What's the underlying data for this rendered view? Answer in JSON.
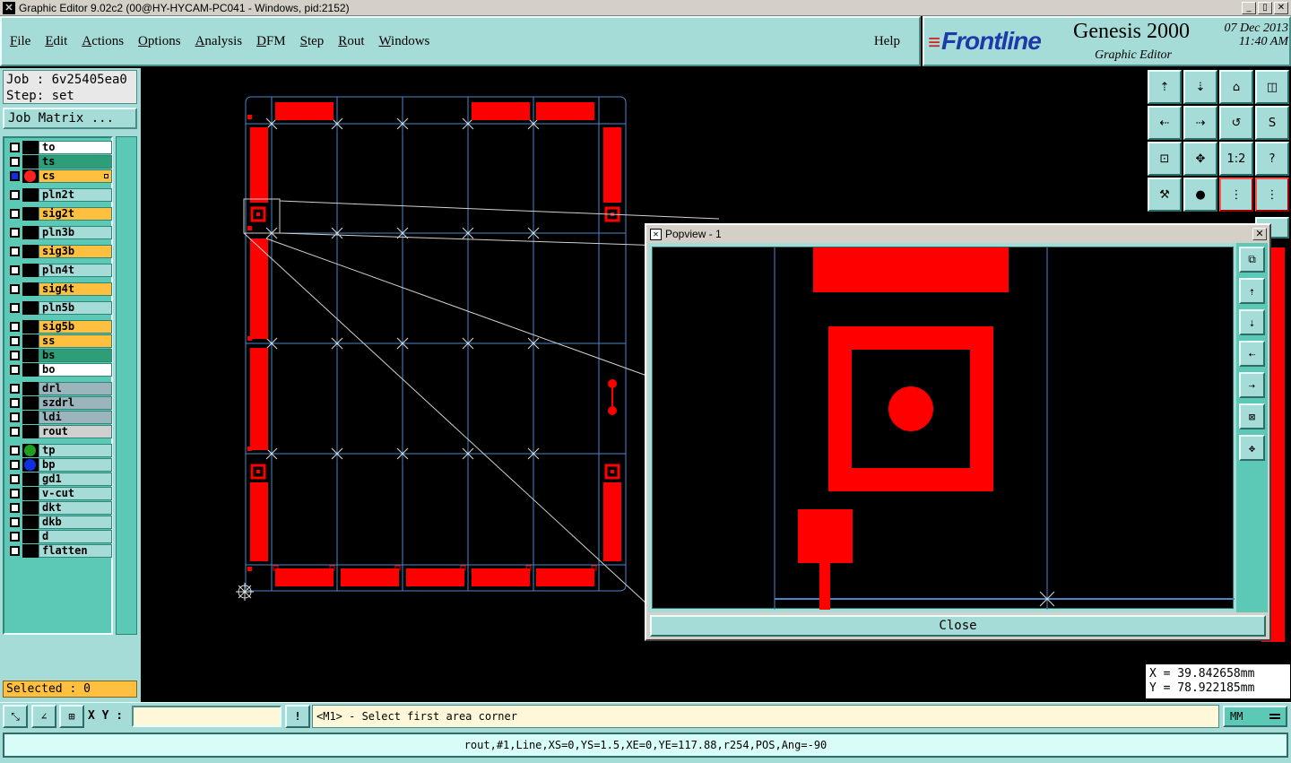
{
  "window": {
    "title": "Graphic Editor 9.02c2 (00@HY-HYCAM-PC041 - Windows, pid:2152)",
    "min_label": "_",
    "max_label": "▯",
    "close_label": "✕"
  },
  "menu": {
    "items": [
      {
        "first": "F",
        "rest": "ile"
      },
      {
        "first": "E",
        "rest": "dit"
      },
      {
        "first": "A",
        "rest": "ctions"
      },
      {
        "first": "O",
        "rest": "ptions"
      },
      {
        "first": "A",
        "rest": "nalysis"
      },
      {
        "first": "D",
        "rest": "FM"
      },
      {
        "first": "S",
        "rest": "tep"
      },
      {
        "first": "R",
        "rest": "out"
      },
      {
        "first": "W",
        "rest": "indows"
      }
    ],
    "help": "Help"
  },
  "brand": {
    "logo": "Frontline",
    "product": "Genesis 2000",
    "subtitle": "Graphic Editor",
    "date": "07 Dec 2013",
    "time": "11:40 AM"
  },
  "job": {
    "job_line": "Job : 6v25405ea0",
    "step_line": "Step: set",
    "matrix_button": "Job Matrix ..."
  },
  "layers": [
    {
      "name": "to",
      "color": "#ffffff"
    },
    {
      "name": "ts",
      "color": "#2e9e78"
    },
    {
      "name": "cs",
      "color": "#ffc040",
      "dot": "#ff2020",
      "active": true
    },
    {
      "name": "pln2t",
      "color": "#a6dcd8"
    },
    {
      "name": "sig2t",
      "color": "#ffc040"
    },
    {
      "name": "pln3b",
      "color": "#a6dcd8"
    },
    {
      "name": "sig3b",
      "color": "#ffc040"
    },
    {
      "name": "pln4t",
      "color": "#a6dcd8"
    },
    {
      "name": "sig4t",
      "color": "#ffc040"
    },
    {
      "name": "pln5b",
      "color": "#a6dcd8"
    },
    {
      "name": "sig5b",
      "color": "#ffc040"
    },
    {
      "name": "ss",
      "color": "#ffc040"
    },
    {
      "name": "bs",
      "color": "#2e9e78"
    },
    {
      "name": "bo",
      "color": "#ffffff"
    },
    {
      "name": "drl",
      "color": "#9cb4bc"
    },
    {
      "name": "szdrl",
      "color": "#9cb4bc"
    },
    {
      "name": "ldi",
      "color": "#9cb4bc"
    },
    {
      "name": "rout",
      "color": "#d0d0d0"
    },
    {
      "name": "tp",
      "color": "#a6dcd8",
      "dot": "#20a020"
    },
    {
      "name": "bp",
      "color": "#a6dcd8",
      "dot": "#1030e0"
    },
    {
      "name": "gd1",
      "color": "#a6dcd8"
    },
    {
      "name": "v-cut",
      "color": "#a6dcd8"
    },
    {
      "name": "dkt",
      "color": "#a6dcd8"
    },
    {
      "name": "dkb",
      "color": "#a6dcd8"
    },
    {
      "name": "d",
      "color": "#a6dcd8"
    },
    {
      "name": "flatten",
      "color": "#a6dcd8"
    }
  ],
  "selected": "Selected : 0",
  "popview": {
    "title": "Popview - 1",
    "close_button": "Close"
  },
  "coords": {
    "x": "X  = 39.842658mm",
    "y": "Y  = 78.922185mm"
  },
  "toolbar": {
    "xy_label": "X Y :",
    "xy_value": "",
    "alert_label": "!",
    "prompt": "<M1> - Select first area corner",
    "units": "MM",
    "one_to_two": "1:2",
    "help_q": "?"
  },
  "status": "rout,#1,Line,XS=0,YS=1.5,XE=0,YE=117.88,r254,POS,Ang=-90",
  "colors": {
    "copper": "#ff0000",
    "grid": "#4a86c8",
    "panel": "#a6dcd8",
    "canvas": "#000000"
  }
}
